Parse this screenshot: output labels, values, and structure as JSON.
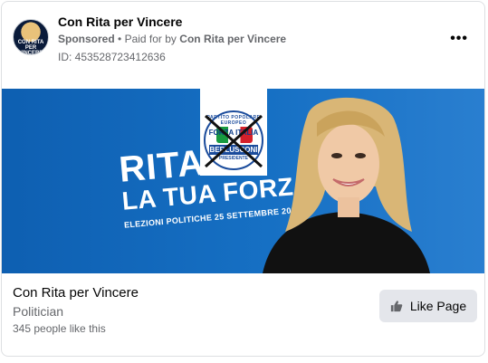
{
  "header": {
    "page_name": "Con Rita per Vincere",
    "sponsored": "Sponsored",
    "separator": "•",
    "paid_for_by_prefix": "Paid for by",
    "paid_for_by_name": "Con Rita per Vincere",
    "ad_id": "ID: 453528723412636",
    "more_icon": "more-options-icon",
    "avatar_text": "CON RITA PER VINCERE"
  },
  "banner": {
    "headline_1": "RITA",
    "headline_2": "LA TUA FORZA",
    "subline_prefix": "ELEZIONI POLITICHE",
    "subline_date": "25 SETTEMBRE 2022",
    "logo_ring": "PARTITO POPOLARE EUROPEO",
    "logo_forza": "FORZA ITALIA",
    "logo_name": "BERLUSCONI",
    "logo_sub": "PRESIDENTE",
    "bg_color": "#1670c4"
  },
  "footer": {
    "page_name": "Con Rita per Vincere",
    "category": "Politician",
    "likes": "345 people like this",
    "like_button": "Like Page",
    "like_icon": "thumbs-up-icon"
  }
}
